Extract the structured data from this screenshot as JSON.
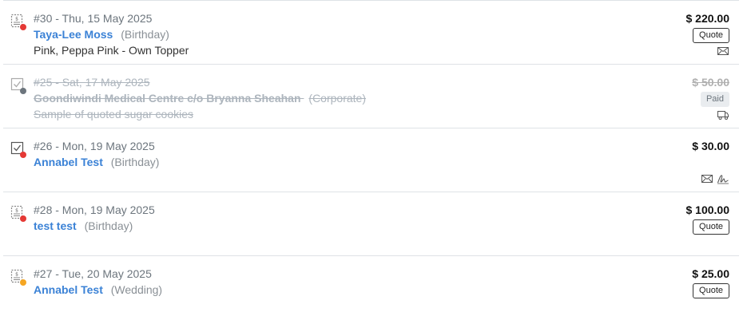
{
  "colors": {
    "link": "#3b82d6",
    "dot_red": "#e53935",
    "dot_gray": "#6c757d",
    "dot_orange": "#f5a623"
  },
  "orders": [
    {
      "order_line": "#30 - Thu, 15 May 2025",
      "customer": "Taya-Lee Moss",
      "event_type": "(Birthday)",
      "description": "Pink, Peppa Pink - Own Topper",
      "amount": "$ 220.00",
      "badge": "Quote",
      "status_icon": "quote-doc-icon",
      "dot_color": "#e53935",
      "icons": [
        "mail-icon"
      ]
    },
    {
      "order_line": "#25 - Sat, 17 May 2025",
      "customer": "Goondiwindi Medical Centre c/o Bryanna Sheahan",
      "event_type": "(Corporate)",
      "description": "Sample of quoted sugar cookies",
      "amount": "$ 50.00",
      "badge": "Paid",
      "status_icon": "check-box-icon",
      "dot_color": "#6c757d",
      "icons": [
        "delivery-truck-icon"
      ]
    },
    {
      "order_line": "#26 - Mon, 19 May 2025",
      "customer": "Annabel Test",
      "event_type": "(Birthday)",
      "description": "",
      "amount": "$ 30.00",
      "badge": "",
      "status_icon": "check-box-icon",
      "dot_color": "#e53935",
      "icons": [
        "mail-icon",
        "signature-icon"
      ]
    },
    {
      "order_line": "#28 - Mon, 19 May 2025",
      "customer": "test test",
      "event_type": "(Birthday)",
      "description": "",
      "amount": "$ 100.00",
      "badge": "Quote",
      "status_icon": "quote-doc-icon",
      "dot_color": "#e53935",
      "icons": []
    },
    {
      "order_line": "#27 - Tue, 20 May 2025",
      "customer": "Annabel Test",
      "event_type": "(Wedding)",
      "description": "",
      "amount": "$ 25.00",
      "badge": "Quote",
      "status_icon": "quote-doc-icon",
      "dot_color": "#f5a623",
      "icons": []
    }
  ]
}
